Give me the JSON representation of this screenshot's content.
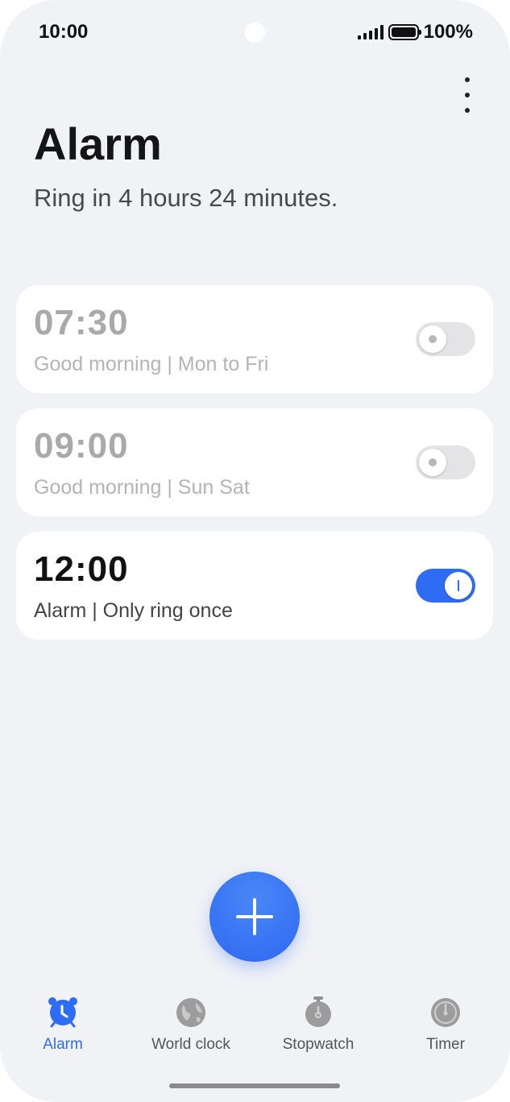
{
  "status_bar": {
    "time": "10:00",
    "battery": "100%"
  },
  "header": {
    "title": "Alarm",
    "subtitle": "Ring in 4 hours 24 minutes."
  },
  "alarms": [
    {
      "time": "07:30",
      "label": "Good morning | Mon to Fri",
      "enabled": false
    },
    {
      "time": "09:00",
      "label": "Good morning | Sun Sat",
      "enabled": false
    },
    {
      "time": "12:00",
      "label": "Alarm | Only ring once",
      "enabled": true
    }
  ],
  "tabs": [
    {
      "label": "Alarm",
      "icon": "alarm-clock-icon",
      "active": true
    },
    {
      "label": "World clock",
      "icon": "globe-icon",
      "active": false
    },
    {
      "label": "Stopwatch",
      "icon": "stopwatch-icon",
      "active": false
    },
    {
      "label": "Timer",
      "icon": "timer-icon",
      "active": false
    }
  ],
  "colors": {
    "accent": "#2f6cf4",
    "background": "#f1f2f6",
    "card": "#ffffff"
  },
  "icons": {
    "more": "more-vertical-icon",
    "add": "plus-icon"
  }
}
